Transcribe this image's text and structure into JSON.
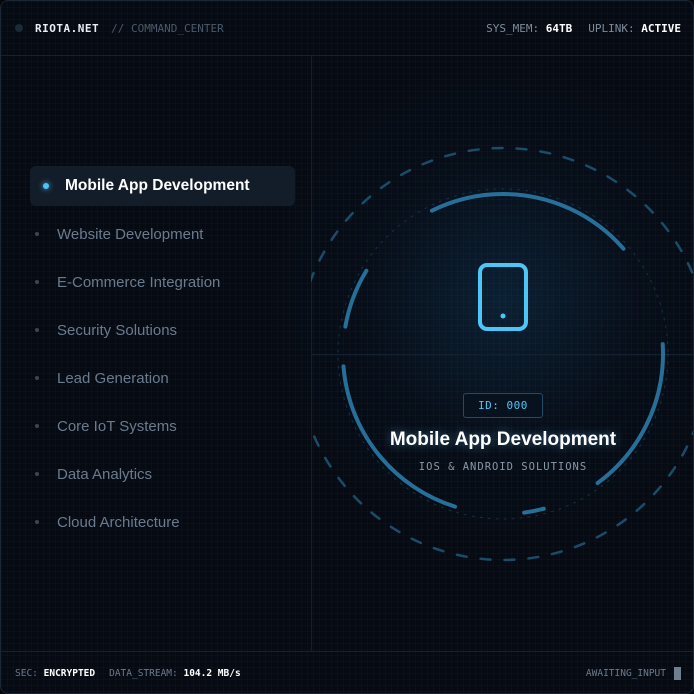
{
  "header": {
    "brand": "RIOTA.NET",
    "section": "// COMMAND_CENTER",
    "sys_mem_label": "SYS_MEM:",
    "sys_mem_value": "64TB",
    "uplink_label": "UPLINK:",
    "uplink_value": "ACTIVE"
  },
  "menu": {
    "items": [
      {
        "label": "Mobile App Development",
        "active": true
      },
      {
        "label": "Website Development",
        "active": false
      },
      {
        "label": "E-Commerce Integration",
        "active": false
      },
      {
        "label": "Security Solutions",
        "active": false
      },
      {
        "label": "Lead Generation",
        "active": false
      },
      {
        "label": "Core IoT Systems",
        "active": false
      },
      {
        "label": "Data Analytics",
        "active": false
      },
      {
        "label": "Cloud Architecture",
        "active": false
      }
    ]
  },
  "detail": {
    "id": "ID: 000",
    "title": "Mobile App Development",
    "subtitle": "IOS & ANDROID SOLUTIONS",
    "icon": "smartphone-icon"
  },
  "footer": {
    "sec_label": "SEC:",
    "sec_value": "ENCRYPTED",
    "stream_label": "DATA_STREAM:",
    "stream_value": "104.2 MB/s",
    "status": "AWAITING_INPUT"
  },
  "colors": {
    "accent": "#4cc6f5",
    "background": "#060a12",
    "active_item_bg": "#131c29"
  }
}
